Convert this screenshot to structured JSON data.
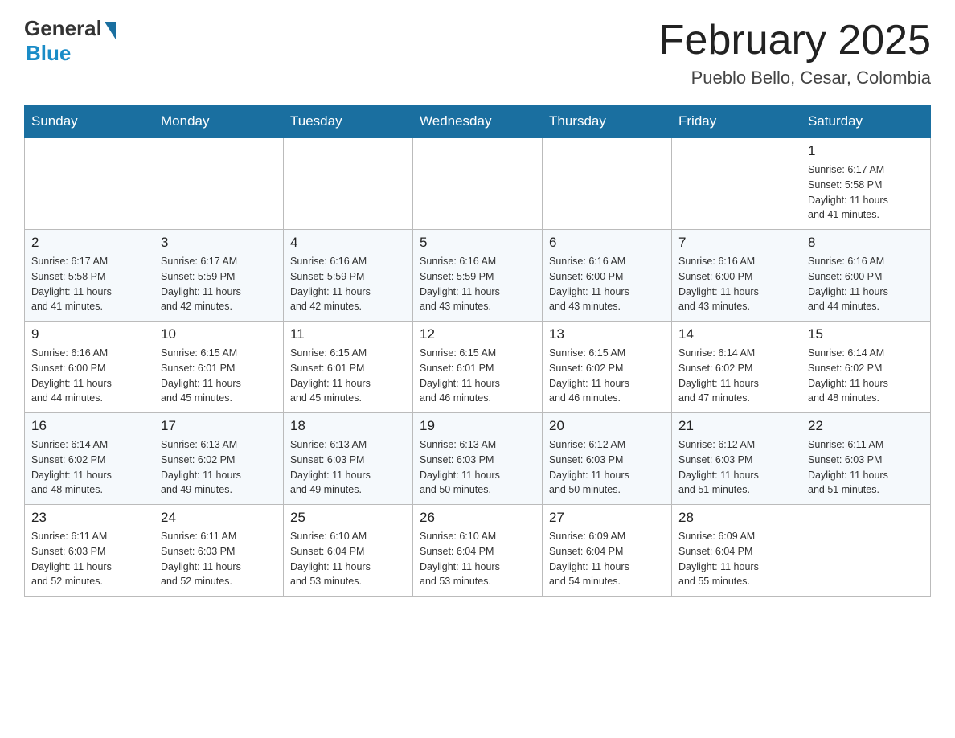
{
  "header": {
    "logo": {
      "general": "General",
      "blue": "Blue"
    },
    "title": "February 2025",
    "location": "Pueblo Bello, Cesar, Colombia"
  },
  "calendar": {
    "days_of_week": [
      "Sunday",
      "Monday",
      "Tuesday",
      "Wednesday",
      "Thursday",
      "Friday",
      "Saturday"
    ],
    "weeks": [
      {
        "days": [
          {
            "date": "",
            "info": ""
          },
          {
            "date": "",
            "info": ""
          },
          {
            "date": "",
            "info": ""
          },
          {
            "date": "",
            "info": ""
          },
          {
            "date": "",
            "info": ""
          },
          {
            "date": "",
            "info": ""
          },
          {
            "date": "1",
            "info": "Sunrise: 6:17 AM\nSunset: 5:58 PM\nDaylight: 11 hours\nand 41 minutes."
          }
        ]
      },
      {
        "days": [
          {
            "date": "2",
            "info": "Sunrise: 6:17 AM\nSunset: 5:58 PM\nDaylight: 11 hours\nand 41 minutes."
          },
          {
            "date": "3",
            "info": "Sunrise: 6:17 AM\nSunset: 5:59 PM\nDaylight: 11 hours\nand 42 minutes."
          },
          {
            "date": "4",
            "info": "Sunrise: 6:16 AM\nSunset: 5:59 PM\nDaylight: 11 hours\nand 42 minutes."
          },
          {
            "date": "5",
            "info": "Sunrise: 6:16 AM\nSunset: 5:59 PM\nDaylight: 11 hours\nand 43 minutes."
          },
          {
            "date": "6",
            "info": "Sunrise: 6:16 AM\nSunset: 6:00 PM\nDaylight: 11 hours\nand 43 minutes."
          },
          {
            "date": "7",
            "info": "Sunrise: 6:16 AM\nSunset: 6:00 PM\nDaylight: 11 hours\nand 43 minutes."
          },
          {
            "date": "8",
            "info": "Sunrise: 6:16 AM\nSunset: 6:00 PM\nDaylight: 11 hours\nand 44 minutes."
          }
        ]
      },
      {
        "days": [
          {
            "date": "9",
            "info": "Sunrise: 6:16 AM\nSunset: 6:00 PM\nDaylight: 11 hours\nand 44 minutes."
          },
          {
            "date": "10",
            "info": "Sunrise: 6:15 AM\nSunset: 6:01 PM\nDaylight: 11 hours\nand 45 minutes."
          },
          {
            "date": "11",
            "info": "Sunrise: 6:15 AM\nSunset: 6:01 PM\nDaylight: 11 hours\nand 45 minutes."
          },
          {
            "date": "12",
            "info": "Sunrise: 6:15 AM\nSunset: 6:01 PM\nDaylight: 11 hours\nand 46 minutes."
          },
          {
            "date": "13",
            "info": "Sunrise: 6:15 AM\nSunset: 6:02 PM\nDaylight: 11 hours\nand 46 minutes."
          },
          {
            "date": "14",
            "info": "Sunrise: 6:14 AM\nSunset: 6:02 PM\nDaylight: 11 hours\nand 47 minutes."
          },
          {
            "date": "15",
            "info": "Sunrise: 6:14 AM\nSunset: 6:02 PM\nDaylight: 11 hours\nand 48 minutes."
          }
        ]
      },
      {
        "days": [
          {
            "date": "16",
            "info": "Sunrise: 6:14 AM\nSunset: 6:02 PM\nDaylight: 11 hours\nand 48 minutes."
          },
          {
            "date": "17",
            "info": "Sunrise: 6:13 AM\nSunset: 6:02 PM\nDaylight: 11 hours\nand 49 minutes."
          },
          {
            "date": "18",
            "info": "Sunrise: 6:13 AM\nSunset: 6:03 PM\nDaylight: 11 hours\nand 49 minutes."
          },
          {
            "date": "19",
            "info": "Sunrise: 6:13 AM\nSunset: 6:03 PM\nDaylight: 11 hours\nand 50 minutes."
          },
          {
            "date": "20",
            "info": "Sunrise: 6:12 AM\nSunset: 6:03 PM\nDaylight: 11 hours\nand 50 minutes."
          },
          {
            "date": "21",
            "info": "Sunrise: 6:12 AM\nSunset: 6:03 PM\nDaylight: 11 hours\nand 51 minutes."
          },
          {
            "date": "22",
            "info": "Sunrise: 6:11 AM\nSunset: 6:03 PM\nDaylight: 11 hours\nand 51 minutes."
          }
        ]
      },
      {
        "days": [
          {
            "date": "23",
            "info": "Sunrise: 6:11 AM\nSunset: 6:03 PM\nDaylight: 11 hours\nand 52 minutes."
          },
          {
            "date": "24",
            "info": "Sunrise: 6:11 AM\nSunset: 6:03 PM\nDaylight: 11 hours\nand 52 minutes."
          },
          {
            "date": "25",
            "info": "Sunrise: 6:10 AM\nSunset: 6:04 PM\nDaylight: 11 hours\nand 53 minutes."
          },
          {
            "date": "26",
            "info": "Sunrise: 6:10 AM\nSunset: 6:04 PM\nDaylight: 11 hours\nand 53 minutes."
          },
          {
            "date": "27",
            "info": "Sunrise: 6:09 AM\nSunset: 6:04 PM\nDaylight: 11 hours\nand 54 minutes."
          },
          {
            "date": "28",
            "info": "Sunrise: 6:09 AM\nSunset: 6:04 PM\nDaylight: 11 hours\nand 55 minutes."
          },
          {
            "date": "",
            "info": ""
          }
        ]
      }
    ]
  }
}
